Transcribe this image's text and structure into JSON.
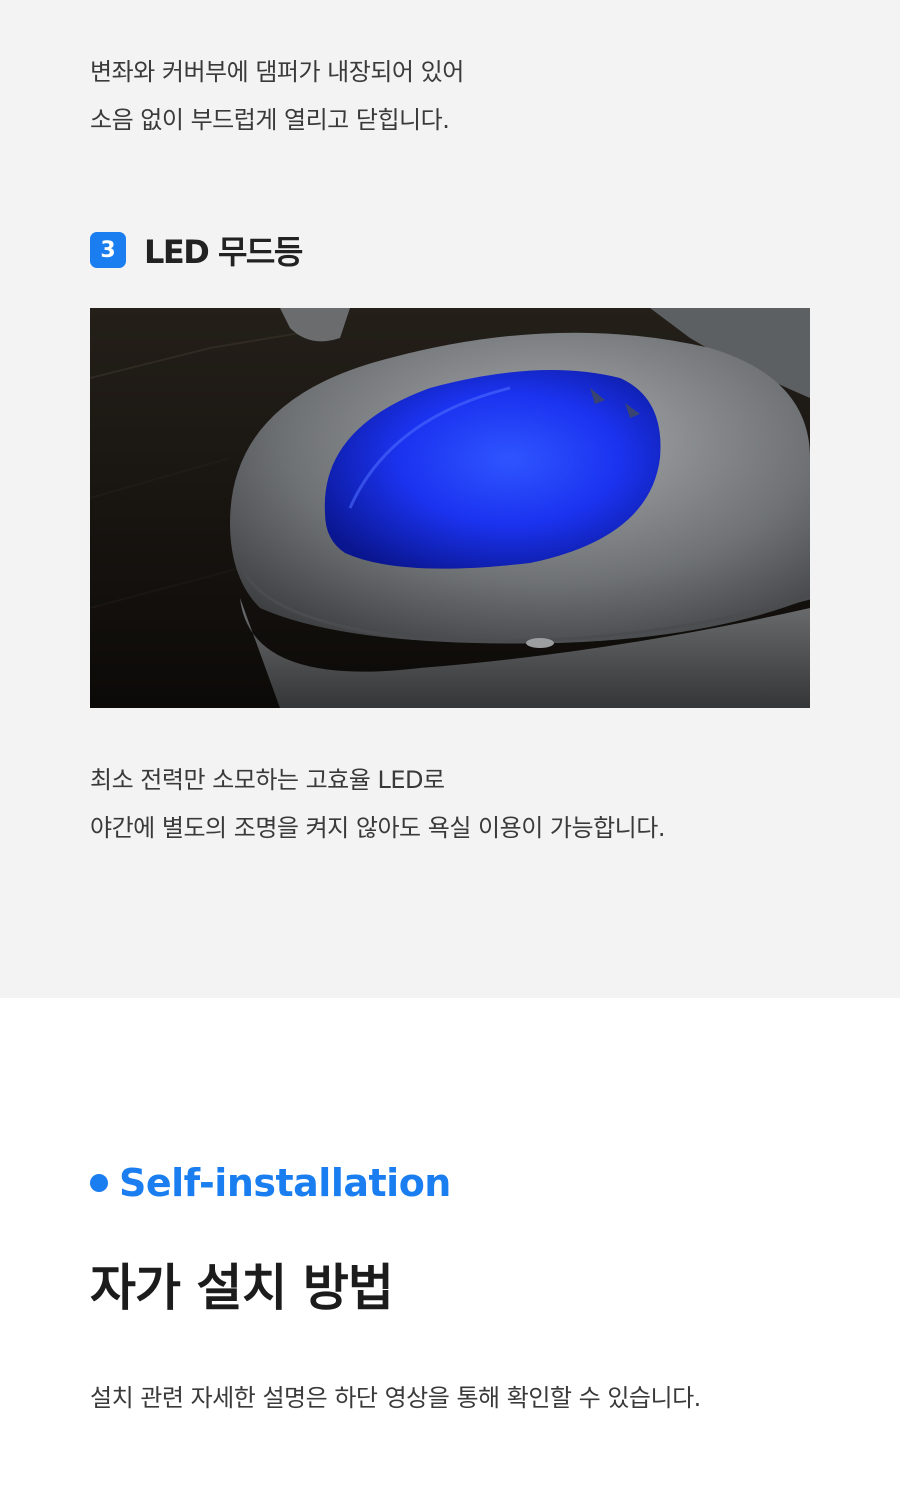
{
  "intro": {
    "lines": [
      "변좌와 커버부에 댐퍼가 내장되어 있어",
      "소음 없이 부드럽게 열리고 닫힙니다."
    ]
  },
  "feature": {
    "number": "3",
    "title": "LED 무드등",
    "photo_icon": "toilet-led-photo",
    "led_color": "#1f3cff",
    "description": [
      "최소 전력만 소모하는 고효율 LED로",
      "야간에 별도의 조명을 켜지 않아도 욕실 이용이 가능합니다."
    ]
  },
  "install": {
    "eyebrow": "Self-installation",
    "title": "자가 설치 방법",
    "description": "설치 관련 자세한 설명은 하단 영상을 통해 확인할 수 있습니다."
  },
  "colors": {
    "accent": "#1a7ef0",
    "gray_bg": "#f3f3f3",
    "white_bg": "#ffffff"
  }
}
